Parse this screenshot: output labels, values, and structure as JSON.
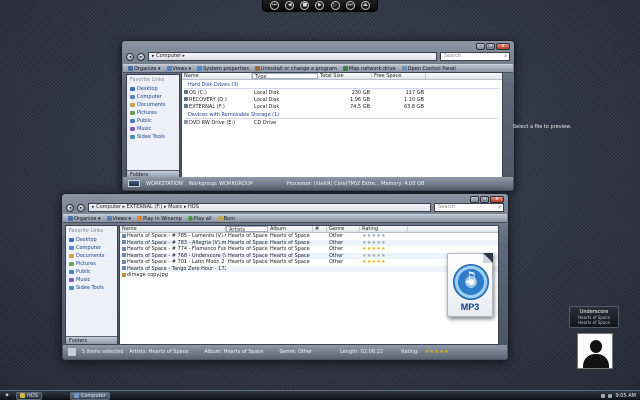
{
  "media_bar": {
    "buttons": [
      {
        "name": "previous-icon",
        "glyph": "⏮"
      },
      {
        "name": "rewind-icon",
        "glyph": "◀"
      },
      {
        "name": "stop-icon",
        "glyph": "■"
      },
      {
        "name": "play-icon",
        "glyph": "▶"
      },
      {
        "name": "forward-icon",
        "glyph": "▷"
      },
      {
        "name": "next-icon",
        "glyph": "⏭"
      },
      {
        "name": "eject-icon",
        "glyph": "⏏"
      }
    ]
  },
  "computer_window": {
    "address": "▸ Computer ▸",
    "search_placeholder": "Search",
    "toolbar": {
      "organize": "Organize ▾",
      "views": "Views ▾",
      "system_properties": "System properties",
      "uninstall": "Uninstall or change a program",
      "map_drive": "Map network drive",
      "control_panel": "Open Control Panel"
    },
    "nav": {
      "header": "Favorite Links",
      "items": [
        "Desktop",
        "Computer",
        "Documents",
        "Pictures",
        "Public",
        "Music",
        "Sidee Tools"
      ],
      "folders": "Folders"
    },
    "columns": [
      "Name",
      "Type",
      "Total Size",
      "Free Space"
    ],
    "groups": {
      "hdd": "Hard Disk Drives (3)",
      "removable": "Devices with Removable Storage (1)"
    },
    "drives": [
      {
        "name": "OS (C:)",
        "type": "Local Disk",
        "total": "230 GB",
        "free": "117 GB"
      },
      {
        "name": "RECOVERY (D:)",
        "type": "Local Disk",
        "total": "1.96 GB",
        "free": "1.10 GB"
      },
      {
        "name": "EXTERNAL (F:)",
        "type": "Local Disk",
        "total": "74.5 GB",
        "free": "63.8 GB"
      }
    ],
    "removable": [
      {
        "name": "DVD RW Drive (E:)",
        "type": "CD Drive",
        "total": "",
        "free": ""
      }
    ],
    "preview": "Select a file to preview.",
    "details": {
      "name": "WORKSTATION",
      "workgroup": "Workgroup: WORKGROUP",
      "processor": "Processor: Intel(R) Core(TM)2 Extre...  Memory: 4.00 GB"
    }
  },
  "music_window": {
    "address": "▸ Computer ▸ EXTERNAL (F:) ▸ Music ▸ HOS",
    "search_placeholder": "Search",
    "toolbar": {
      "organize": "Organize ▾",
      "views": "Views ▾",
      "play_in": "Play in Winamp",
      "play_all": "Play all",
      "burn": "Burn"
    },
    "nav": {
      "header": "Favorite Links",
      "items": [
        "Desktop",
        "Computer",
        "Documents",
        "Pictures",
        "Public",
        "Music",
        "Sidee Tools"
      ],
      "folders": "Folders"
    },
    "columns": [
      "Name",
      "Artists",
      "Album",
      "#",
      "Genre",
      "Rating"
    ],
    "files": [
      {
        "name": "Hearts of Space - # 785 - Lamento (V).mp3",
        "artist": "Hearts of Space",
        "album": "Hearts of Space",
        "num": "",
        "genre": "Other",
        "rating": 0
      },
      {
        "name": "Hearts of Space - # 783 - Allegria (V).mp3",
        "artist": "Hearts of Space",
        "album": "Hearts of Space",
        "num": "",
        "genre": "Other",
        "rating": 0
      },
      {
        "name": "Hearts of Space - # 774 - Flamenco Fusion (V).mp3",
        "artist": "Hearts of Space",
        "album": "Hearts of Space",
        "num": "",
        "genre": "Other",
        "rating": 5
      },
      {
        "name": "Hearts of Space - # 768 - Underscore (V).mp3",
        "artist": "Hearts of Space",
        "album": "Hearts of Space",
        "num": "",
        "genre": "Other",
        "rating": 0
      },
      {
        "name": "Hearts of Space - # 701 - Latin Moon 2 (V).mp3",
        "artist": "Hearts of Space",
        "album": "Hearts of Space",
        "num": "",
        "genre": "Other",
        "rating": 5
      },
      {
        "name": "Hearts of Space - Tango Zero Hour - 172.mp3",
        "artist": "",
        "album": "",
        "num": "",
        "genre": "",
        "rating": -1
      },
      {
        "name": "dimage copy.jpg",
        "artist": "",
        "album": "",
        "num": "",
        "genre": "",
        "rating": -1
      }
    ],
    "details": {
      "selected": "5 items selected",
      "artists": "Artists: Hearts of Space",
      "album": "Album: Hearts of Space",
      "genre": "Genre: Other",
      "length": "Length: 02:06:22",
      "rating": "Rating:"
    }
  },
  "mp3_icon": {
    "label": "MP3"
  },
  "now_playing": {
    "title": "Underscore",
    "artist": "Hearts of Space",
    "album": "Hearts of Space"
  },
  "taskbar": {
    "start_icon": "start-orb-icon",
    "items": [
      "HOS",
      "Computer"
    ],
    "clock": "9:05 AM"
  }
}
